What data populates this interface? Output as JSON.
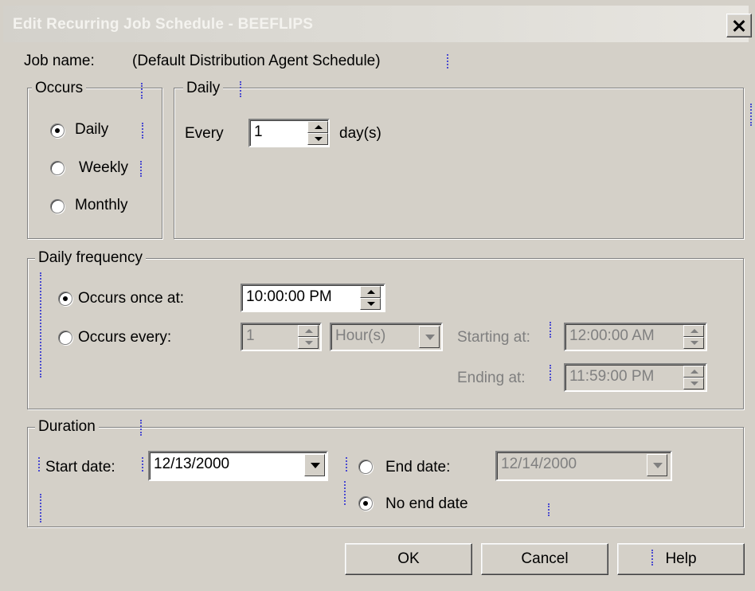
{
  "window": {
    "title": "Edit Recurring Job Schedule - BEEFLIPS"
  },
  "job": {
    "name_label": "Job name:",
    "name_value": "(Default Distribution Agent Schedule)"
  },
  "occurs": {
    "legend": "Occurs",
    "options": [
      {
        "label": "Daily",
        "checked": true
      },
      {
        "label": "Weekly",
        "checked": false
      },
      {
        "label": "Monthly",
        "checked": false
      }
    ]
  },
  "daily": {
    "legend": "Daily",
    "every_label": "Every",
    "every_value": "1",
    "unit_label": "day(s)"
  },
  "daily_frequency": {
    "legend": "Daily frequency",
    "once_label": "Occurs once at:",
    "once_value": "10:00:00 PM",
    "once_checked": true,
    "every_label": "Occurs every:",
    "every_value": "1",
    "every_unit": "Hour(s)",
    "starting_label": "Starting at:",
    "starting_value": "12:00:00 AM",
    "ending_label": "Ending at:",
    "ending_value": "11:59:00 PM"
  },
  "duration": {
    "legend": "Duration",
    "start_label": "Start date:",
    "start_value": "12/13/2000",
    "end_label": "End date:",
    "end_value": "12/14/2000",
    "end_checked": false,
    "no_end_label": "No end date",
    "no_end_checked": true
  },
  "buttons": {
    "ok": "OK",
    "cancel": "Cancel",
    "help": "Help"
  }
}
